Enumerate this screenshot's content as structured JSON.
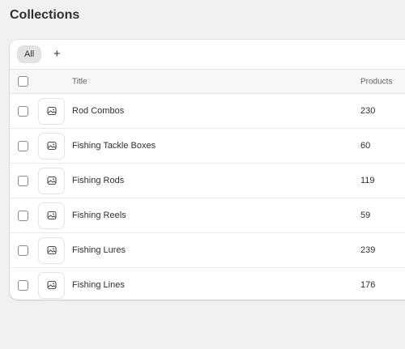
{
  "page": {
    "title": "Collections"
  },
  "tabs": {
    "items": [
      {
        "label": "All"
      }
    ],
    "add_label": "+"
  },
  "table": {
    "columns": {
      "title": "Title",
      "products": "Products"
    },
    "rows": [
      {
        "title": "Rod Combos",
        "products": "230",
        "image_icon": "image-placeholder-icon"
      },
      {
        "title": "Fishing Tackle Boxes",
        "products": "60",
        "image_icon": "image-placeholder-icon"
      },
      {
        "title": "Fishing Rods",
        "products": "119",
        "image_icon": "image-placeholder-icon"
      },
      {
        "title": "Fishing Reels",
        "products": "59",
        "image_icon": "image-placeholder-icon"
      },
      {
        "title": "Fishing Lures",
        "products": "239",
        "image_icon": "image-placeholder-icon"
      },
      {
        "title": "Fishing Lines",
        "products": "176",
        "image_icon": "image-placeholder-icon"
      }
    ]
  }
}
